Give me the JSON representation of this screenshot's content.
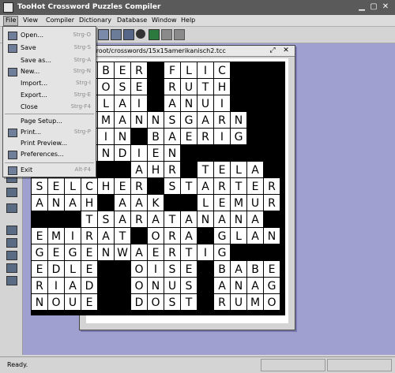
{
  "app": {
    "title": "TooHot Crossword Puzzles Compiler"
  },
  "menubar": [
    "File",
    "View",
    "Compiler",
    "Dictionary",
    "Database",
    "Window",
    "Help"
  ],
  "file_menu": [
    {
      "label": "Open...",
      "shortcut": "Strg-O",
      "icon": "open-folder-icon"
    },
    {
      "label": "Save",
      "shortcut": "Strg-S",
      "icon": "save-disk-icon"
    },
    {
      "label": "Save as...",
      "shortcut": "Strg-A",
      "icon": ""
    },
    {
      "label": "New...",
      "shortcut": "Strg-N",
      "icon": "new-document-icon"
    },
    {
      "label": "Import...",
      "shortcut": "Strg-I",
      "icon": ""
    },
    {
      "label": "Export...",
      "shortcut": "Strg-E",
      "icon": ""
    },
    {
      "label": "Close",
      "shortcut": "Strg-F4",
      "icon": ""
    },
    {
      "label": "Page Setup...",
      "shortcut": "",
      "icon": ""
    },
    {
      "label": "Print...",
      "shortcut": "Strg-P",
      "icon": "printer-icon"
    },
    {
      "label": "Print Preview...",
      "shortcut": "",
      "icon": ""
    },
    {
      "label": "Preferences...",
      "shortcut": "",
      "icon": "preferences-icon"
    },
    {
      "label": "Exit",
      "shortcut": "Alt-F4",
      "icon": "exit-icon"
    }
  ],
  "document": {
    "title": "/root/crosswords/15x15amerikanisch2.tcc"
  },
  "status": {
    "text": "Ready."
  },
  "grid": [
    "#NEEBER#FLIC###",
    "#A#TOSE#RUTH###",
    "#M#ALAI#ANUI###",
    "#LEEMANNSGARN##",
    "#S#RIN#BAERIG##",
    "##FUNDIEN######",
    "#E####AHR#TELA#",
    "SELCHER#STARTER",
    "ANAH#AAK##LEMUR",
    "###TSARATANANA#",
    "EMIRAT#ORA#GLAN",
    "GEGENWAERTIG###",
    "EDLE##OISE#BABEL",
    "RIAD##ONUS#ANAGA",
    "NOUE##DOST#RUMOR"
  ]
}
